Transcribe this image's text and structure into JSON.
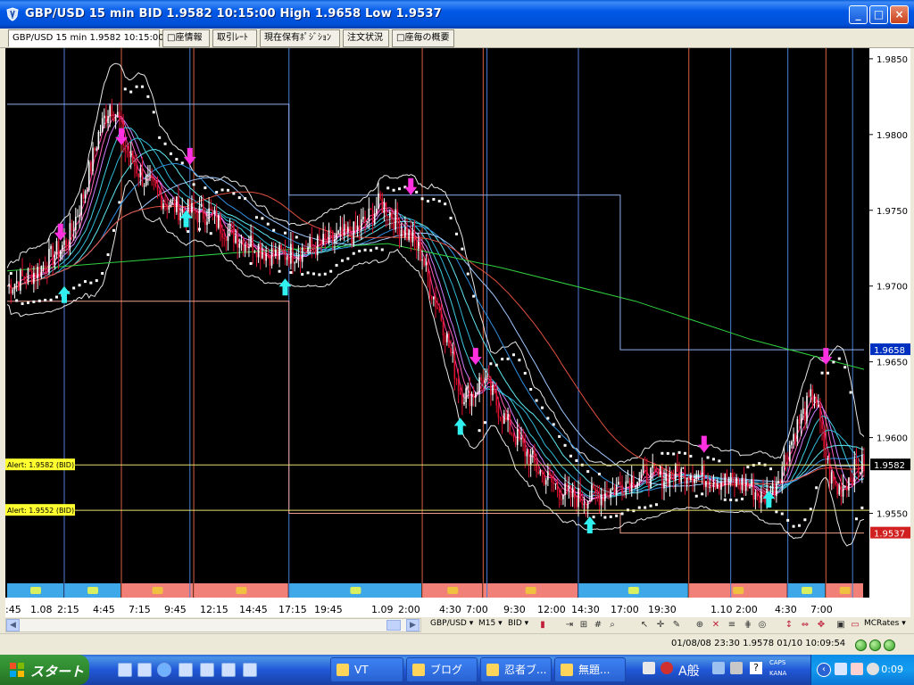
{
  "window": {
    "title": "GBP/USD 15 min BID 1.9582 10:15:00 High 1.9658 Low 1.9537",
    "minimize": "_",
    "maximize": "□",
    "close": "×"
  },
  "tabs": [
    {
      "label": "GBP/USD 15 min 1.9582 10:15:00",
      "active": true
    },
    {
      "label": "□座情報"
    },
    {
      "label": "取引ﾚｰﾄ"
    },
    {
      "label": "現在保有ﾎﾟｼﾞｼｮﾝ"
    },
    {
      "label": "注文状況"
    },
    {
      "label": "□座毎の概要"
    }
  ],
  "chart_data": {
    "type": "line",
    "symbol": "GBP/USD",
    "timeframe": "15 min",
    "price_axis": {
      "ylim": [
        1.9505,
        1.9857
      ],
      "ticks": [
        "1.9850",
        "1.9800",
        "1.9750",
        "1.9700",
        "1.9650",
        "1.9600",
        "1.9550"
      ],
      "tick_values": [
        1.985,
        1.98,
        1.975,
        1.97,
        1.965,
        1.96,
        1.955
      ],
      "high_label": "1.9658",
      "high_value": 1.9658,
      "current_label": "1.9582",
      "current_value": 1.9582,
      "low_label": "1.9537",
      "low_value": 1.9537
    },
    "time_axis_labels": [
      ":45",
      "1.08",
      "2:15",
      "4:45",
      "7:15",
      "9:45",
      "12:15",
      "14:45",
      "17:15",
      "19:45",
      "1.09",
      "2:00",
      "4:30",
      "7:00",
      "9:30",
      "12:00",
      "14:30",
      "17:00",
      "19:30",
      "1.10",
      "2:00",
      "4:30",
      "7:00"
    ],
    "alerts": [
      {
        "label": "Alert: 1.9582 (BID)",
        "value": 1.9582
      },
      {
        "label": "Alert: 1.9552 (BID)",
        "value": 1.9552
      }
    ],
    "close_path": [
      [
        0,
        1.97
      ],
      [
        8,
        1.9705
      ],
      [
        16,
        1.971
      ],
      [
        24,
        1.972
      ],
      [
        32,
        1.973
      ],
      [
        40,
        1.976
      ],
      [
        48,
        1.98
      ],
      [
        54,
        1.982
      ],
      [
        58,
        1.9812
      ],
      [
        62,
        1.979
      ],
      [
        66,
        1.9782
      ],
      [
        72,
        1.977
      ],
      [
        78,
        1.9762
      ],
      [
        84,
        1.9755
      ],
      [
        92,
        1.975
      ],
      [
        100,
        1.9748
      ],
      [
        106,
        1.9748
      ],
      [
        112,
        1.974
      ],
      [
        118,
        1.9735
      ],
      [
        124,
        1.973
      ],
      [
        130,
        1.9728
      ],
      [
        136,
        1.9722
      ],
      [
        142,
        1.972
      ],
      [
        150,
        1.9722
      ],
      [
        158,
        1.9725
      ],
      [
        166,
        1.9728
      ],
      [
        174,
        1.9732
      ],
      [
        182,
        1.9735
      ],
      [
        190,
        1.9745
      ],
      [
        196,
        1.9755
      ],
      [
        200,
        1.975
      ],
      [
        206,
        1.974
      ],
      [
        212,
        1.9732
      ],
      [
        218,
        1.972
      ],
      [
        222,
        1.97
      ],
      [
        228,
        1.968
      ],
      [
        232,
        1.966
      ],
      [
        238,
        1.963
      ],
      [
        244,
        1.9628
      ],
      [
        250,
        1.964
      ],
      [
        256,
        1.9625
      ],
      [
        262,
        1.961
      ],
      [
        270,
        1.9595
      ],
      [
        278,
        1.958
      ],
      [
        286,
        1.957
      ],
      [
        294,
        1.9562
      ],
      [
        302,
        1.956
      ],
      [
        310,
        1.9562
      ],
      [
        318,
        1.9566
      ],
      [
        326,
        1.9572
      ],
      [
        334,
        1.9575
      ],
      [
        342,
        1.9574
      ],
      [
        350,
        1.9575
      ],
      [
        358,
        1.9578
      ],
      [
        366,
        1.9574
      ],
      [
        374,
        1.9572
      ],
      [
        382,
        1.957
      ],
      [
        390,
        1.9568
      ],
      [
        396,
        1.956
      ],
      [
        402,
        1.9565
      ],
      [
        408,
        1.9585
      ],
      [
        414,
        1.9605
      ],
      [
        420,
        1.962
      ],
      [
        424,
        1.963
      ],
      [
        428,
        1.96
      ],
      [
        432,
        1.9575
      ],
      [
        436,
        1.9565
      ],
      [
        440,
        1.957
      ],
      [
        446,
        1.958
      ],
      [
        450,
        1.9582
      ]
    ],
    "ma_slow_green": [
      [
        0,
        1.971
      ],
      [
        120,
        1.9722
      ],
      [
        200,
        1.9728
      ],
      [
        260,
        1.9712
      ],
      [
        330,
        1.969
      ],
      [
        390,
        1.9665
      ],
      [
        450,
        1.9645
      ]
    ],
    "up_arrows": [
      [
        30,
        1.97
      ],
      [
        94,
        1.975
      ],
      [
        146,
        1.9705
      ],
      [
        238,
        1.9613
      ],
      [
        306,
        1.9548
      ],
      [
        400,
        1.9565
      ]
    ],
    "down_arrows": [
      [
        28,
        1.973
      ],
      [
        60,
        1.9793
      ],
      [
        96,
        1.978
      ],
      [
        212,
        1.976
      ],
      [
        246,
        1.9648
      ],
      [
        366,
        1.959
      ],
      [
        430,
        1.9648
      ]
    ],
    "background_bands": {
      "orange_tones": true,
      "blue_tones": true
    }
  },
  "toolbar": {
    "symbol": "GBP/USD ▾",
    "timeframe": "M15 ▾",
    "price_type": "BID ▾",
    "rates_menu": "MCRates ▾"
  },
  "statusbar": {
    "text": "01/08/08 23:30   1.9578   01/10 10:09:54"
  },
  "taskbar": {
    "start": "スタート",
    "buttons": [
      {
        "label": "VT"
      },
      {
        "label": "ブログ"
      },
      {
        "label": "忍者ブ..."
      },
      {
        "label": "無題..."
      }
    ],
    "ime": "A般",
    "clock": "0:09",
    "caps": "CAPS",
    "kana": "KANA"
  }
}
